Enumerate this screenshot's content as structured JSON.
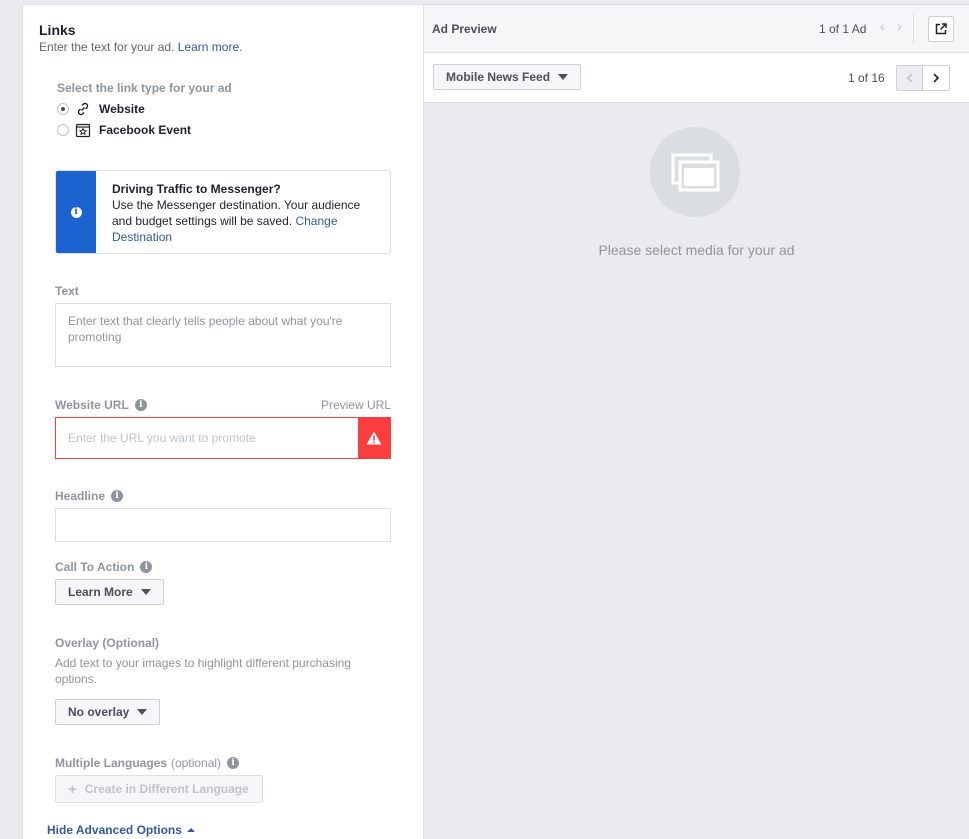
{
  "links": {
    "title": "Links",
    "subtitle": "Enter the text for your ad.",
    "learn_more_link": "Learn more.",
    "link_type_label": "Select the link type for your ad",
    "options": [
      {
        "label": "Website",
        "selected": true,
        "icon": "link-icon"
      },
      {
        "label": "Facebook Event",
        "selected": false,
        "icon": "event-icon"
      }
    ]
  },
  "info": {
    "heading": "Driving Traffic to Messenger?",
    "body": "Use the Messenger destination. Your audience and budget settings will be saved.",
    "link": "Change Destination",
    "accent": "#1a63d1"
  },
  "text_field": {
    "label": "Text",
    "placeholder": "Enter text that clearly tells people about what you're promoting"
  },
  "website_url": {
    "label": "Website URL",
    "preview_link": "Preview URL",
    "placeholder": "Enter the URL you want to promote",
    "error_color": "#fa3e3e"
  },
  "headline": {
    "label": "Headline"
  },
  "call_to_action": {
    "label": "Call To Action",
    "value": "Learn More"
  },
  "overlay": {
    "label": "Overlay (Optional)",
    "description": "Add text to your images to highlight different purchasing options.",
    "value": "No overlay"
  },
  "languages": {
    "label": "Multiple Languages",
    "optional": "(optional)",
    "button": "Create in Different Language"
  },
  "advanced": {
    "label": "Hide Advanced Options"
  },
  "preview": {
    "title": "Ad Preview",
    "ad_count": "1 of 1 Ad",
    "placement": "Mobile News Feed",
    "page_count": "1 of 16",
    "empty_message": "Please select media for your ad"
  }
}
